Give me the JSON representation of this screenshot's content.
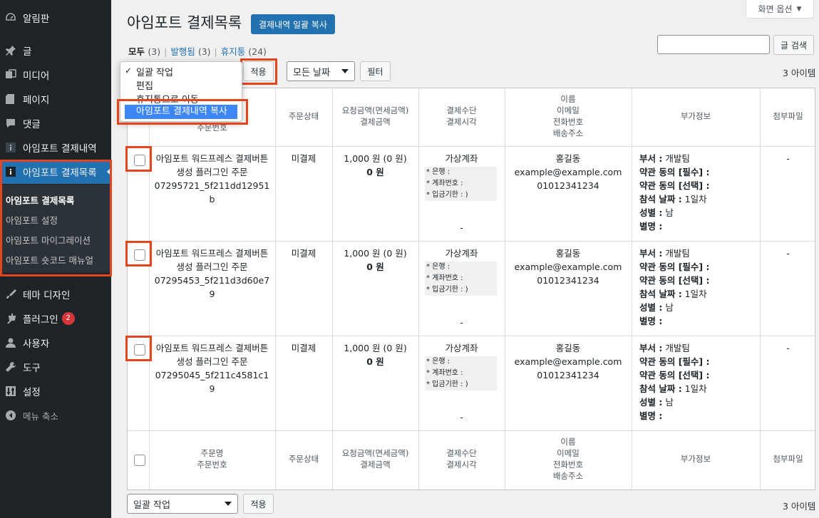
{
  "sidebar": {
    "items": [
      {
        "label": "알림판",
        "icon": "dashboard-icon"
      },
      {
        "label": "글",
        "icon": "pin-icon"
      },
      {
        "label": "미디어",
        "icon": "media-icon"
      },
      {
        "label": "페이지",
        "icon": "page-icon"
      },
      {
        "label": "댓글",
        "icon": "comment-icon"
      },
      {
        "label": "아임포트 결제내역",
        "icon": "info-icon"
      },
      {
        "label": "아임포트 결제목록",
        "icon": "info-icon"
      },
      {
        "label": "테마 디자인",
        "icon": "brush-icon"
      },
      {
        "label": "플러그인",
        "icon": "plugin-icon",
        "badge": "2"
      },
      {
        "label": "사용자",
        "icon": "user-icon"
      },
      {
        "label": "도구",
        "icon": "wrench-icon"
      },
      {
        "label": "설정",
        "icon": "settings-icon"
      },
      {
        "label": "메뉴 축소",
        "icon": "collapse-icon"
      }
    ],
    "submenu": [
      "아임포트 결제목록",
      "아임포트 설정",
      "아임포트 마이그레이션",
      "아임포트 숏코드 매뉴얼"
    ]
  },
  "screen_options": "화면 옵션",
  "page_title": "아임포트 결제목록",
  "copy_all_button": "결제내역 일괄 복사",
  "views": {
    "all": {
      "label": "모두",
      "count": "(3)"
    },
    "published": {
      "label": "발행됨",
      "count": "(3)"
    },
    "trash": {
      "label": "휴지통",
      "count": "(24)"
    },
    "sep": "|"
  },
  "search_button": "글 검색",
  "top_nav": {
    "apply": "적용",
    "date_select": "모든 날짜",
    "filter": "필터",
    "item_count": "3 아이템"
  },
  "bulk_dropdown": {
    "check": "✓",
    "options": [
      "일괄 작업",
      "편집",
      "휴지통으로 이동"
    ],
    "selected": "아임포트 결제내역 복사"
  },
  "table": {
    "headers": {
      "name": [
        "주문명",
        "주문번호"
      ],
      "status": [
        "주문상태"
      ],
      "amount": [
        "요청금액(면세금액)",
        "결제금액"
      ],
      "method": [
        "결제수단",
        "결제시각"
      ],
      "customer": [
        "이름",
        "이메일",
        "전화번호",
        "배송주소"
      ],
      "extra": [
        "부가정보"
      ],
      "attach": [
        "첨부파일"
      ]
    },
    "rows": [
      {
        "name": [
          "아임포트 워드프레스 결제버튼",
          "생성 플러그인 주문",
          "07295721_5f211dd12951",
          "b"
        ],
        "status": "미결제",
        "req_amount": "1,000 원 (0 원)",
        "paid_amount": "0 원",
        "method": "가상계좌",
        "bank": [
          "* 은행 :",
          "* 계좌번호 :",
          "* 입금기한 : )"
        ],
        "time": "-",
        "customer": [
          "홍길동",
          "example@example.com",
          "01012341234"
        ],
        "extra": [
          [
            "부서 :",
            " 개발팀"
          ],
          [
            "약관 동의 [필수] :",
            ""
          ],
          [
            "약관 동의 [선택] :",
            ""
          ],
          [
            "참석 날짜 :",
            " 1일차"
          ],
          [
            "성별 :",
            " 남"
          ],
          [
            "별명 :",
            ""
          ]
        ],
        "attach": "-"
      },
      {
        "name": [
          "아임포트 워드프레스 결제버튼",
          "생성 플러그인 주문",
          "07295453_5f211d3d60e7",
          "9"
        ],
        "status": "미결제",
        "req_amount": "1,000 원 (0 원)",
        "paid_amount": "0 원",
        "method": "가상계좌",
        "bank": [
          "* 은행 :",
          "* 계좌번호 :",
          "* 입금기한 : )"
        ],
        "time": "-",
        "customer": [
          "홍길동",
          "example@example.com",
          "01012341234"
        ],
        "extra": [
          [
            "부서 :",
            " 개발팀"
          ],
          [
            "약관 동의 [필수] :",
            ""
          ],
          [
            "약관 동의 [선택] :",
            ""
          ],
          [
            "참석 날짜 :",
            " 1일차"
          ],
          [
            "성별 :",
            " 남"
          ],
          [
            "별명 :",
            ""
          ]
        ],
        "attach": "-"
      },
      {
        "name": [
          "아임포트 워드프레스 결제버튼",
          "생성 플러그인 주문",
          "07295045_5f211c4581c1",
          "9"
        ],
        "status": "미결제",
        "req_amount": "1,000 원 (0 원)",
        "paid_amount": "0 원",
        "method": "가상계좌",
        "bank": [
          "* 은행 :",
          "* 계좌번호 :",
          "* 입금기한 : )"
        ],
        "time": "-",
        "customer": [
          "홍길동",
          "example@example.com",
          "01012341234"
        ],
        "extra": [
          [
            "부서 :",
            " 개발팀"
          ],
          [
            "약관 동의 [필수] :",
            ""
          ],
          [
            "약관 동의 [선택] :",
            ""
          ],
          [
            "참석 날짜 :",
            " 1일차"
          ],
          [
            "성별 :",
            " 남"
          ],
          [
            "별명 :",
            ""
          ]
        ],
        "attach": "-"
      }
    ]
  },
  "bottom_nav": {
    "bulk_select": "일괄 작업",
    "apply": "적용",
    "item_count": "3 아이템"
  },
  "colors": {
    "sidebar_bg": "#1d2327",
    "active_bg": "#2271b1",
    "highlight": "#e4451d",
    "primary": "#2271b1"
  }
}
